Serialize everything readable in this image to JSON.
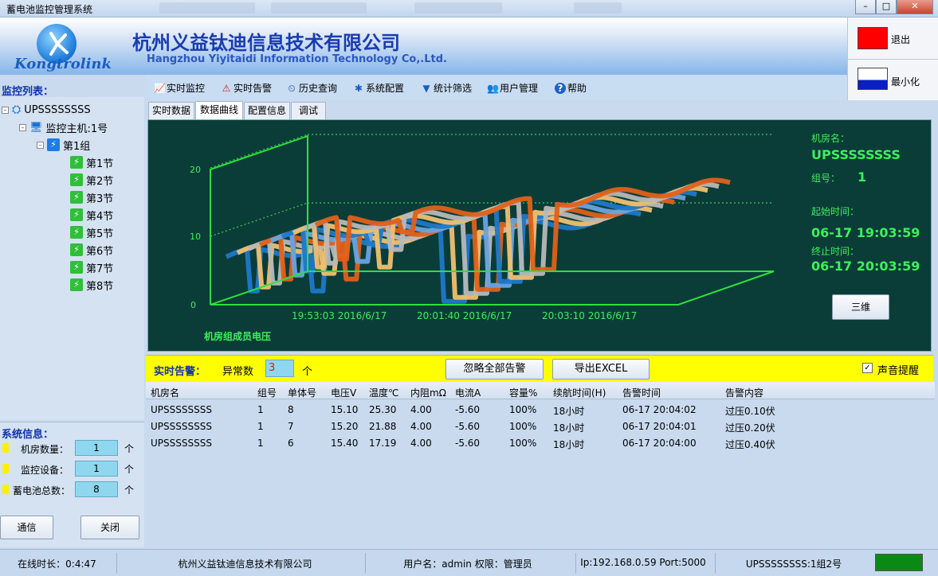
{
  "window": {
    "title": "蓄电池监控管理系统"
  },
  "header": {
    "logo_text": "Kongtrolink",
    "company_cn": "杭州义益钛迪信息技术有限公司",
    "company_en": "Hangzhou Yiyitaidi Information Technology Co,.Ltd."
  },
  "right_panel": {
    "exit_label": "退出",
    "minimize_label": "最小化",
    "exit_color": "#ff0000",
    "minimize_color": "#0a20c0"
  },
  "toolbar": {
    "items": [
      "实时监控",
      "实时告警",
      "历史查询",
      "系统配置",
      "统计筛选",
      "用户管理",
      "帮助"
    ]
  },
  "sidebar": {
    "title": "监控列表：",
    "root": "UPSSSSSSSS",
    "host": "监控主机:1号",
    "group": "第1组",
    "cells": [
      "第1节",
      "第2节",
      "第3节",
      "第4节",
      "第5节",
      "第6节",
      "第7节",
      "第8节"
    ]
  },
  "sysinfo": {
    "title": "系统信息：",
    "rows": [
      {
        "label": "机房数量：",
        "value": "1",
        "unit": "个"
      },
      {
        "label": "监控设备：",
        "value": "1",
        "unit": "个"
      },
      {
        "label": "蓄电池总数：",
        "value": "8",
        "unit": "个"
      }
    ]
  },
  "buttons": {
    "comm": "通信",
    "close": "关闭"
  },
  "tabs": [
    "实时数据",
    "数据曲线",
    "配置信息",
    "调试"
  ],
  "chart_info": {
    "room_label": "机房名：",
    "room_value": "UPSSSSSSSS",
    "group_label": "组号：",
    "group_value": "1",
    "start_label": "起始时间：",
    "start_value": "06-17 19:03:59",
    "end_label": "终止时间：",
    "end_value": "06-17 20:03:59",
    "btn_3d": "三维"
  },
  "chart_data": {
    "type": "line",
    "title": "机房组成员电压",
    "x_ticks": [
      "19:53:03 2016/6/17",
      "20:01:40 2016/6/17",
      "20:03:10 2016/6/17"
    ],
    "y_ticks": [
      "0",
      "10",
      "20"
    ],
    "ylim": [
      0,
      20
    ],
    "grid": true,
    "series_colors": [
      "#1f78c8",
      "#f0c070",
      "#b8b8b8",
      "#e0601a",
      "#6aa3e0"
    ]
  },
  "alarm": {
    "title": "实时告警：",
    "count_label": "异常数",
    "count": "3",
    "count_unit": "个",
    "ignore_btn": "忽略全部告警",
    "export_btn": "导出EXCEL",
    "sound_label": "声音提醒",
    "sound_checked": "✓"
  },
  "table": {
    "headers": [
      "机房名",
      "组号",
      "单体号",
      "电压V",
      "温度℃",
      "内阻mΩ",
      "电流A",
      "容量%",
      "续航时间(H)",
      "告警时间",
      "告警内容"
    ],
    "rows": [
      [
        "UPSSSSSSSS",
        "1",
        "8",
        "15.10",
        "25.30",
        "4.00",
        "-5.60",
        "100%",
        "18小时",
        "06-17 20:04:02",
        "过压0.10伏"
      ],
      [
        "UPSSSSSSSS",
        "1",
        "7",
        "15.20",
        "21.88",
        "4.00",
        "-5.60",
        "100%",
        "18小时",
        "06-17 20:04:01",
        "过压0.20伏"
      ],
      [
        "UPSSSSSSSS",
        "1",
        "6",
        "15.40",
        "17.19",
        "4.00",
        "-5.60",
        "100%",
        "18小时",
        "06-17 20:04:00",
        "过压0.40伏"
      ]
    ]
  },
  "status": {
    "online": "在线时长：0:4:47",
    "company": "杭州义益钛迪信息技术有限公司",
    "user": "用户名：admin 权限：管理员",
    "ip": "Ip:192.168.0.59 Port:5000",
    "device": "UPSSSSSSSS:1组2号"
  }
}
